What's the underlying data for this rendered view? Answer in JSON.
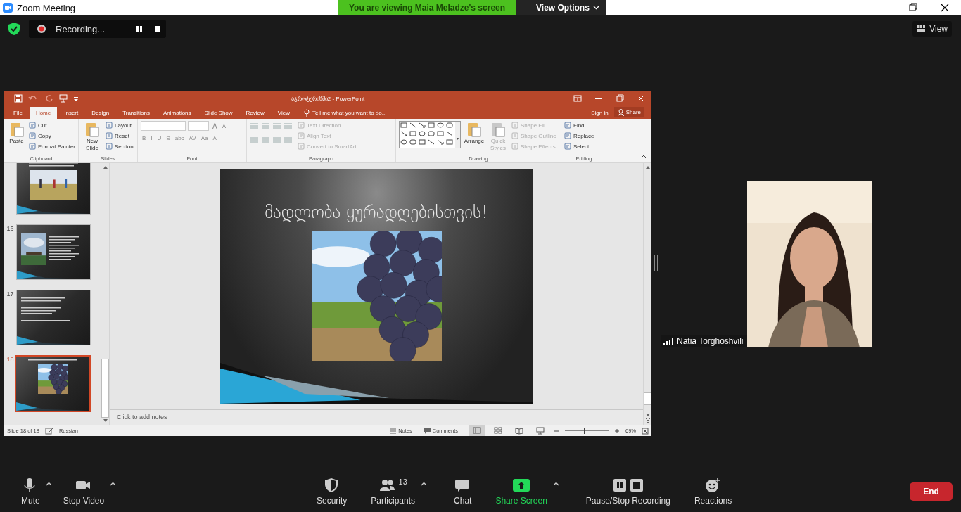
{
  "app": {
    "title": "Zoom Meeting"
  },
  "share_banner": {
    "message": "You are viewing Maia Meladze's screen",
    "options": "View Options"
  },
  "recording": {
    "label": "Recording..."
  },
  "view_button": {
    "label": "View"
  },
  "powerpoint": {
    "title": "აგროტურიზმი2 - PowerPoint",
    "tabs": [
      {
        "label": "File",
        "selected": false
      },
      {
        "label": "Home",
        "selected": true
      },
      {
        "label": "Insert",
        "selected": false
      },
      {
        "label": "Design",
        "selected": false
      },
      {
        "label": "Transitions",
        "selected": false
      },
      {
        "label": "Animations",
        "selected": false
      },
      {
        "label": "Slide Show",
        "selected": false
      },
      {
        "label": "Review",
        "selected": false
      },
      {
        "label": "View",
        "selected": false
      }
    ],
    "tell_me": "Tell me what you want to do...",
    "sign_in": "Sign in",
    "share": "Share",
    "ribbon_groups": [
      {
        "label": "Clipboard",
        "items": [
          {
            "kind": "large",
            "label": "Paste",
            "disabled": false
          },
          {
            "kind": "stack",
            "items": [
              {
                "label": "Cut",
                "disabled": false
              },
              {
                "label": "Copy",
                "disabled": false
              },
              {
                "label": "Format Painter",
                "disabled": false
              }
            ]
          }
        ]
      },
      {
        "label": "Slides",
        "items": [
          {
            "kind": "large",
            "label": "New Slide",
            "disabled": false
          },
          {
            "kind": "stack",
            "items": [
              {
                "label": "Layout",
                "disabled": false
              },
              {
                "label": "Reset",
                "disabled": false
              },
              {
                "label": "Section",
                "disabled": false
              }
            ]
          }
        ]
      },
      {
        "label": "Font",
        "items": [
          {
            "kind": "font",
            "size_buttons": [
              "A",
              "A"
            ],
            "buttons": [
              "B",
              "I",
              "U",
              "S",
              "abc",
              "AV",
              "Aa",
              "A"
            ]
          }
        ]
      },
      {
        "label": "Paragraph",
        "items": [
          {
            "kind": "paragraph"
          },
          {
            "kind": "stack",
            "items": [
              {
                "label": "Text Direction",
                "disabled": true
              },
              {
                "label": "Align Text",
                "disabled": true
              },
              {
                "label": "Convert to SmartArt",
                "disabled": true
              }
            ]
          }
        ]
      },
      {
        "label": "Drawing",
        "items": [
          {
            "kind": "shapes"
          },
          {
            "kind": "large",
            "label": "Arrange",
            "disabled": false
          },
          {
            "kind": "large",
            "label": "Quick Styles",
            "disabled": true
          },
          {
            "kind": "stack",
            "items": [
              {
                "label": "Shape Fill",
                "disabled": true
              },
              {
                "label": "Shape Outline",
                "disabled": true
              },
              {
                "label": "Shape Effects",
                "disabled": true
              }
            ]
          }
        ]
      },
      {
        "label": "Editing",
        "items": [
          {
            "kind": "stack",
            "items": [
              {
                "label": "Find",
                "disabled": false
              },
              {
                "label": "Replace",
                "disabled": false
              },
              {
                "label": "Select",
                "disabled": false
              }
            ]
          }
        ]
      }
    ],
    "thumbnails": [
      {
        "kind": "photo-below",
        "selected": false
      },
      {
        "number": "16",
        "kind": "photo-left",
        "selected": false
      },
      {
        "number": "17",
        "kind": "text",
        "selected": false
      },
      {
        "number": "18",
        "kind": "photo-center",
        "selected": true
      }
    ],
    "slide": {
      "title": "მადლობა ყურადღებისთვის!"
    },
    "notes": {
      "placeholder": "Click to add notes"
    },
    "status_bar": {
      "slide": "Slide 18 of 18",
      "language": "Russian",
      "notes": "Notes",
      "comments": "Comments",
      "views": [
        {
          "kind": "normal",
          "selected": true
        },
        {
          "kind": "sorter",
          "selected": false
        },
        {
          "kind": "reading",
          "selected": false
        },
        {
          "kind": "show",
          "selected": false
        }
      ],
      "zoom": {
        "reading": "69%",
        "level": 0.45
      }
    }
  },
  "participant": {
    "name": "Natia Torghoshvili"
  },
  "toolbar": {
    "left_items": [
      {
        "kind": "mic",
        "label": "Mute",
        "caret": true
      },
      {
        "kind": "video",
        "label": "Stop Video",
        "caret": true
      }
    ],
    "center_items": [
      {
        "kind": "security",
        "label": "Security",
        "caret": false
      },
      {
        "kind": "participants",
        "label": "Participants",
        "count": "13",
        "caret": true
      },
      {
        "kind": "chat",
        "label": "Chat",
        "caret": false
      },
      {
        "kind": "share",
        "label": "Share Screen",
        "caret": true
      },
      {
        "kind": "recording",
        "label": "Pause/Stop Recording",
        "caret": false
      },
      {
        "kind": "reactions",
        "label": "Reactions",
        "caret": false
      }
    ],
    "end": "End"
  }
}
